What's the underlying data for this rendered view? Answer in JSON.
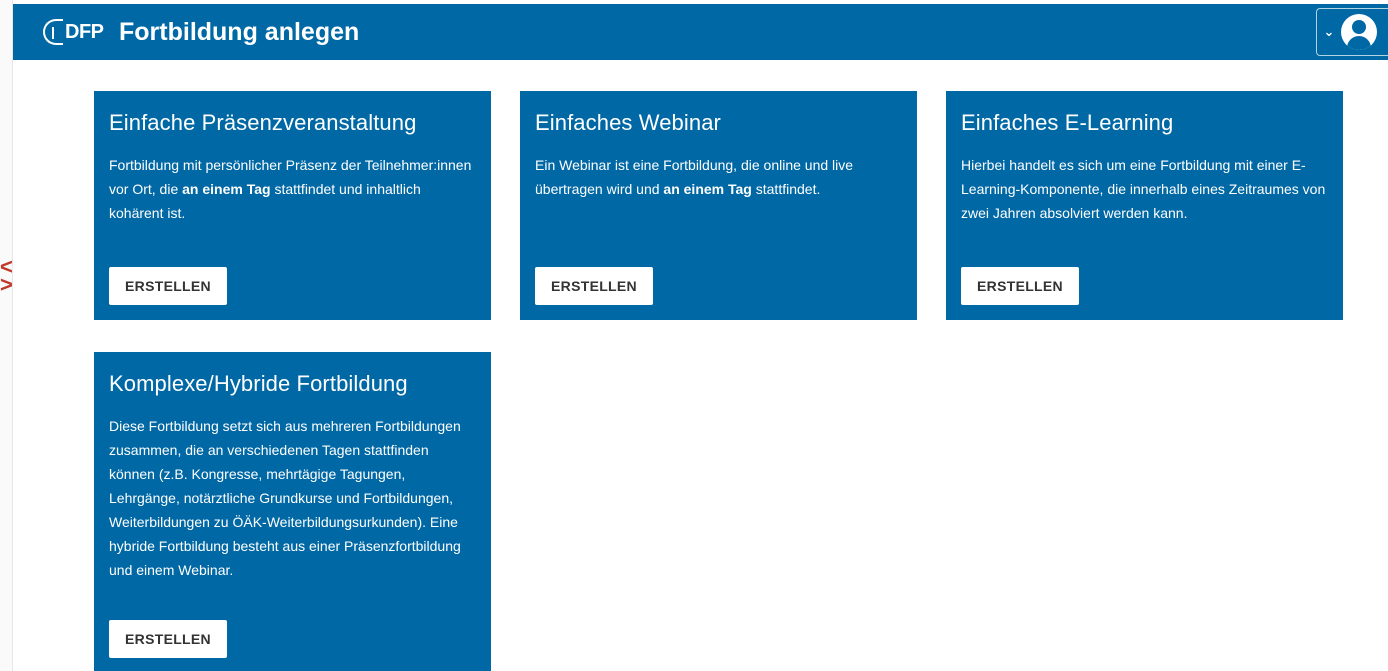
{
  "header": {
    "logo_text": "DFP",
    "title": "Fortbildung anlegen"
  },
  "user_menu": {
    "chevron": "⌄",
    "avatar_icon": "user-avatar-icon"
  },
  "cards": [
    {
      "title": "Einfache Präsenzveranstaltung",
      "desc_a": "Fortbildung mit persönlicher Präsenz der Teilnehmer:innen vor Ort, die ",
      "desc_bold": "an einem Tag",
      "desc_b": " stattfindet und inhaltlich kohärent ist.",
      "button": "ERSTELLEN"
    },
    {
      "title": "Einfaches Webinar",
      "desc_a": "Ein Webinar ist eine Fortbildung, die online und live übertragen wird und ",
      "desc_bold": "an einem Tag",
      "desc_b": " stattfindet.",
      "button": "ERSTELLEN"
    },
    {
      "title": "Einfaches E-Learning",
      "desc": "Hierbei handelt es sich um eine Fortbildung mit einer E-Learning-Komponente, die innerhalb eines Zeitraumes von zwei Jahren absolviert werden kann.",
      "button": "ERSTELLEN"
    },
    {
      "title": "Komplexe/Hybride Fortbildung",
      "desc": "Diese Fortbildung setzt sich aus mehreren Fortbildungen zusammen, die an verschiedenen Tagen stattfinden können (z.B. Kongresse, mehrtägige Tagungen, Lehrgänge, notärztliche Grundkurse und Fortbildungen, Weiterbildungen zu ÖÄK-Weiterbildungsurkunden). Eine hybride Fortbildung besteht aus einer Präsenzfortbildung und einem Webinar.",
      "button": "ERSTELLEN"
    }
  ],
  "colors": {
    "brand": "#0068a5",
    "button_bg": "#ffffff",
    "button_text": "#333333"
  }
}
